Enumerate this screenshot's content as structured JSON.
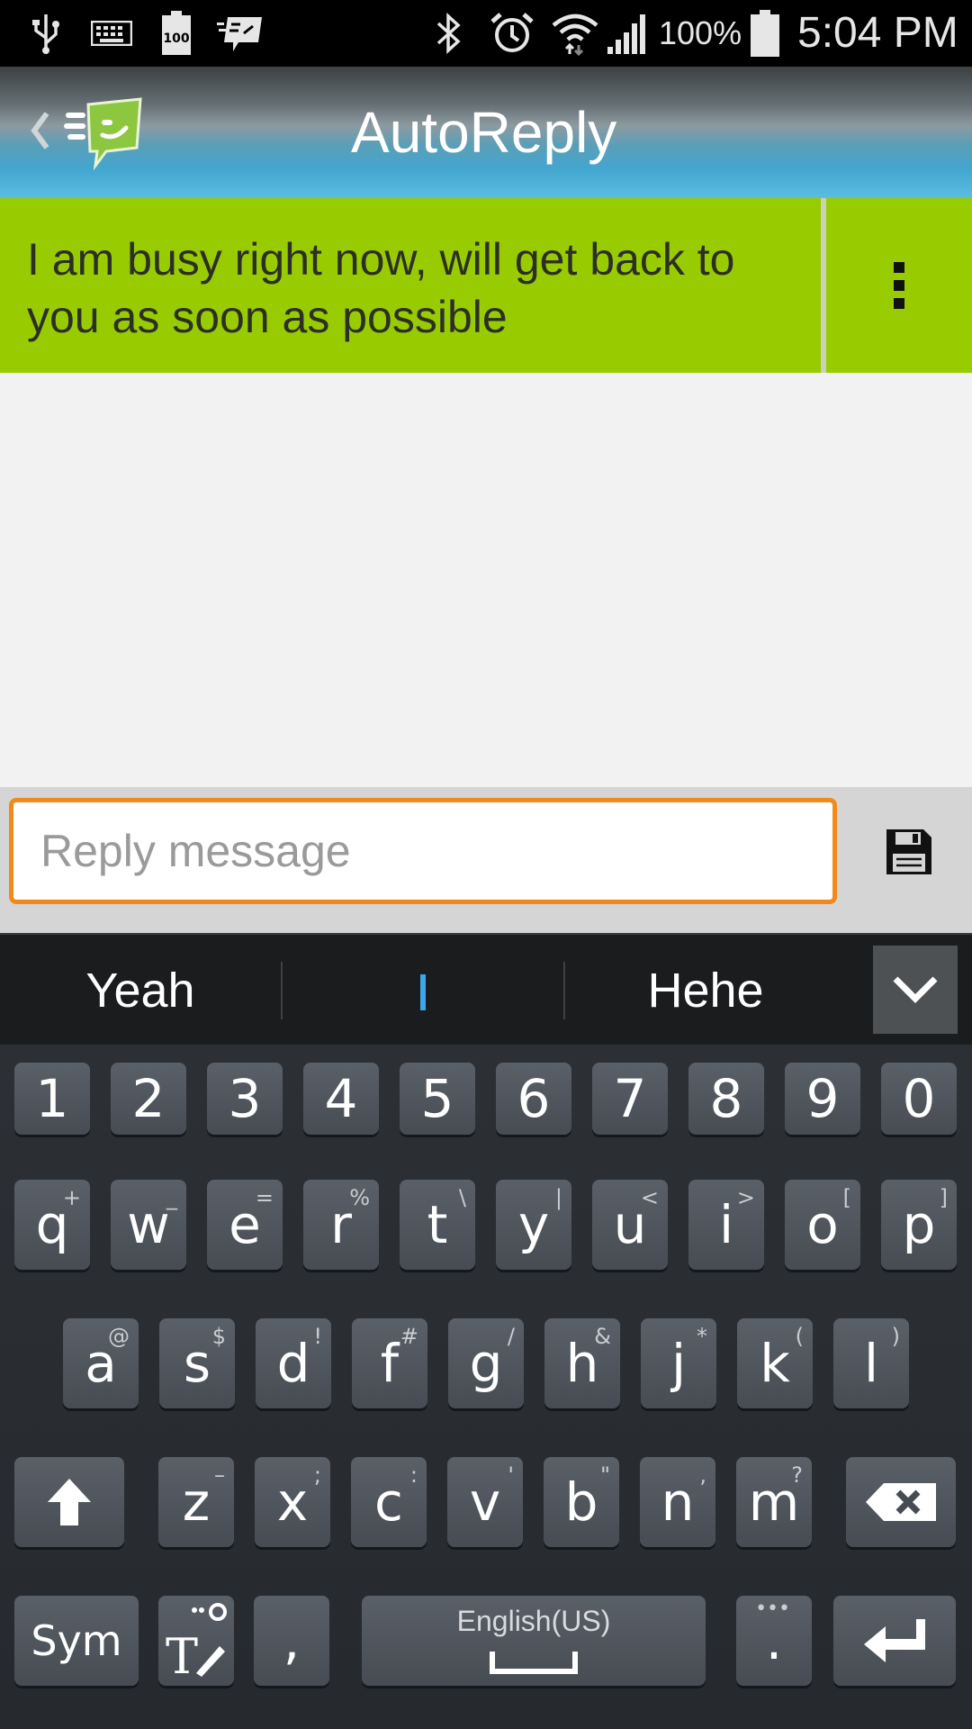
{
  "status_bar": {
    "battery_small_text": "100",
    "battery_percent": "100%",
    "time": "5:04 PM",
    "icons": [
      "usb-icon",
      "keyboard-icon",
      "battery-small-icon",
      "autoreply-notification-icon",
      "bluetooth-icon",
      "alarm-icon",
      "wifi-icon",
      "signal-icon",
      "battery-icon"
    ]
  },
  "action_bar": {
    "title": "AutoReply",
    "icons": [
      "back-chevron-icon",
      "app-logo-icon"
    ]
  },
  "reply_card": {
    "text": "I am busy right now, will get back to you as soon as possible",
    "menu_icon": "overflow-menu-icon"
  },
  "reply_input": {
    "value": "",
    "placeholder": "Reply message",
    "save_icon": "floppy-disk-icon"
  },
  "suggestions": {
    "items": [
      "Yeah",
      "",
      "Hehe"
    ],
    "collapse_icon": "chevron-down-icon"
  },
  "keyboard": {
    "number_row": [
      "1",
      "2",
      "3",
      "4",
      "5",
      "6",
      "7",
      "8",
      "9",
      "0"
    ],
    "row1": [
      {
        "main": "q",
        "sub": "+"
      },
      {
        "main": "w",
        "sub": "_"
      },
      {
        "main": "e",
        "sub": "="
      },
      {
        "main": "r",
        "sub": "%"
      },
      {
        "main": "t",
        "sub": "\\"
      },
      {
        "main": "y",
        "sub": "|"
      },
      {
        "main": "u",
        "sub": "<"
      },
      {
        "main": "i",
        "sub": ">"
      },
      {
        "main": "o",
        "sub": "["
      },
      {
        "main": "p",
        "sub": "]"
      }
    ],
    "row2": [
      {
        "main": "a",
        "sub": "@"
      },
      {
        "main": "s",
        "sub": "$"
      },
      {
        "main": "d",
        "sub": "!"
      },
      {
        "main": "f",
        "sub": "#"
      },
      {
        "main": "g",
        "sub": "/"
      },
      {
        "main": "h",
        "sub": "&"
      },
      {
        "main": "j",
        "sub": "*"
      },
      {
        "main": "k",
        "sub": "("
      },
      {
        "main": "l",
        "sub": ")"
      }
    ],
    "row3": [
      {
        "main": "z",
        "sub": "–"
      },
      {
        "main": "x",
        "sub": ";"
      },
      {
        "main": "c",
        "sub": ":"
      },
      {
        "main": "v",
        "sub": "'"
      },
      {
        "main": "b",
        "sub": "\""
      },
      {
        "main": "n",
        "sub": ","
      },
      {
        "main": "m",
        "sub": "?"
      }
    ],
    "sym_label": "Sym",
    "comma": ",",
    "space_label": "English(US)",
    "period": ".",
    "special_icons": [
      "shift-icon",
      "backspace-icon",
      "handwriting-settings-icon",
      "enter-icon"
    ]
  },
  "colors": {
    "card_green": "#99cc00",
    "input_border_orange": "#f08a1c",
    "action_bar_blue": "#43a6cf",
    "suggestion_cursor_blue": "#3da5ea"
  }
}
